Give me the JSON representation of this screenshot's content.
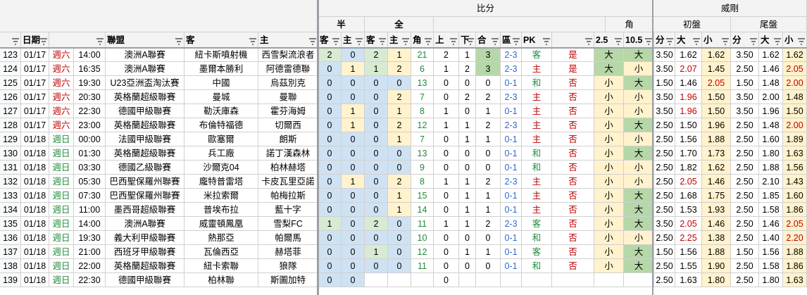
{
  "header": {
    "group_bifen": "比分",
    "group_ban": "半",
    "group_quan": "全",
    "group_jiao": "角",
    "group_weilian": "威剛",
    "group_chupan": "初盤",
    "group_weipan": "尾盤",
    "columns": [
      "日期",
      "",
      "聯盟",
      "客",
      "主",
      "客",
      "主",
      "客",
      "主",
      "角",
      "上",
      "下",
      "合",
      "區",
      "PK",
      "2.5",
      "10.5",
      "分",
      "大",
      "小",
      "分",
      "大",
      "小"
    ]
  },
  "rows": [
    {
      "n": "123",
      "d": "01/17",
      "w": "週六",
      "t": "14:00",
      "lg": "澳洲A聯賽",
      "away": "紐卡斯噴射機",
      "home": "西雪梨流浪者",
      "h1": "2",
      "h2": "0",
      "f1": "2",
      "f2": "1",
      "jiao": "21",
      "up": "2",
      "down": "1",
      "he": "3",
      "qu": "2-3",
      "pk": "客",
      "res": "是",
      "o25": "大",
      "o105": "大",
      "s1": "3.50",
      "s2": "1.62",
      "s3": "1.62",
      "e1": "3.50",
      "e2": "1.62",
      "e3": "1.62"
    },
    {
      "n": "124",
      "d": "01/17",
      "w": "週六",
      "t": "16:35",
      "lg": "澳洲A聯賽",
      "away": "墨爾本勝利",
      "home": "阿德雷德聯",
      "h1": "0",
      "h2": "1",
      "f1": "1",
      "f2": "2",
      "jiao": "6",
      "up": "1",
      "down": "2",
      "he": "3",
      "qu": "2-3",
      "pk": "主",
      "res": "是",
      "o25": "大",
      "o105": "小",
      "s1": "3.50",
      "s2": "2.07",
      "s3": "1.45",
      "e1": "2.50",
      "e2": "1.46",
      "e3": "2.05"
    },
    {
      "n": "125",
      "d": "01/17",
      "w": "週六",
      "t": "19:30",
      "lg": "U23亞洲盃淘汰賽",
      "away": "中國",
      "home": "烏茲別克",
      "h1": "0",
      "h2": "0",
      "f1": "0",
      "f2": "0",
      "jiao": "13",
      "up": "0",
      "down": "0",
      "he": "0",
      "qu": "0-1",
      "pk": "和",
      "res": "否",
      "o25": "小",
      "o105": "大",
      "s1": "1.50",
      "s2": "1.46",
      "s3": "2.05",
      "e1": "1.50",
      "e2": "1.48",
      "e3": "2.00"
    },
    {
      "n": "126",
      "d": "01/17",
      "w": "週六",
      "t": "20:30",
      "lg": "英格蘭超級聯賽",
      "away": "曼城",
      "home": "曼聯",
      "h1": "0",
      "h2": "0",
      "f1": "0",
      "f2": "2",
      "jiao": "7",
      "up": "0",
      "down": "2",
      "he": "2",
      "qu": "2-3",
      "pk": "主",
      "res": "否",
      "o25": "小",
      "o105": "小",
      "s1": "3.50",
      "s2": "1.96",
      "s3": "1.50",
      "e1": "3.50",
      "e2": "2.00",
      "e3": "1.48"
    },
    {
      "n": "127",
      "d": "01/17",
      "w": "週六",
      "t": "22:30",
      "lg": "德國甲級聯賽",
      "away": "勒沃庫森",
      "home": "霍芬海姆",
      "h1": "0",
      "h2": "1",
      "f1": "0",
      "f2": "1",
      "jiao": "8",
      "up": "1",
      "down": "0",
      "he": "1",
      "qu": "0-1",
      "pk": "主",
      "res": "否",
      "o25": "小",
      "o105": "小",
      "s1": "3.50",
      "s2": "1.96",
      "s3": "1.50",
      "e1": "3.50",
      "e2": "1.96",
      "e3": "1.50"
    },
    {
      "n": "128",
      "d": "01/17",
      "w": "週六",
      "t": "23:00",
      "lg": "英格蘭超級聯賽",
      "away": "布倫特福德",
      "home": "切爾西",
      "h1": "0",
      "h2": "1",
      "f1": "0",
      "f2": "2",
      "jiao": "12",
      "up": "1",
      "down": "1",
      "he": "2",
      "qu": "2-3",
      "pk": "主",
      "res": "否",
      "o25": "小",
      "o105": "大",
      "s1": "2.50",
      "s2": "1.50",
      "s3": "1.96",
      "e1": "2.50",
      "e2": "1.48",
      "e3": "2.00"
    },
    {
      "n": "129",
      "d": "01/18",
      "w": "週日",
      "t": "00:00",
      "lg": "法國甲級聯賽",
      "away": "歐塞爾",
      "home": "朗斯",
      "h1": "0",
      "h2": "0",
      "f1": "0",
      "f2": "1",
      "jiao": "7",
      "up": "0",
      "down": "1",
      "he": "1",
      "qu": "0-1",
      "pk": "主",
      "res": "否",
      "o25": "小",
      "o105": "小",
      "s1": "2.50",
      "s2": "1.56",
      "s3": "1.88",
      "e1": "2.50",
      "e2": "1.60",
      "e3": "1.89"
    },
    {
      "n": "130",
      "d": "01/18",
      "w": "週日",
      "t": "01:30",
      "lg": "英格蘭超級聯賽",
      "away": "兵工廠",
      "home": "諾丁漢森林",
      "h1": "0",
      "h2": "0",
      "f1": "0",
      "f2": "0",
      "jiao": "13",
      "up": "0",
      "down": "0",
      "he": "0",
      "qu": "0-1",
      "pk": "和",
      "res": "否",
      "o25": "小",
      "o105": "大",
      "s1": "2.50",
      "s2": "1.70",
      "s3": "1.73",
      "e1": "2.50",
      "e2": "1.80",
      "e3": "1.63"
    },
    {
      "n": "131",
      "d": "01/18",
      "w": "週日",
      "t": "03:30",
      "lg": "德國乙級聯賽",
      "away": "沙爾克04",
      "home": "柏林赫塔",
      "h1": "0",
      "h2": "0",
      "f1": "0",
      "f2": "0",
      "jiao": "9",
      "up": "0",
      "down": "0",
      "he": "0",
      "qu": "0-1",
      "pk": "和",
      "res": "否",
      "o25": "小",
      "o105": "小",
      "s1": "2.50",
      "s2": "1.82",
      "s3": "1.62",
      "e1": "2.50",
      "e2": "1.88",
      "e3": "1.56"
    },
    {
      "n": "132",
      "d": "01/18",
      "w": "週日",
      "t": "05:30",
      "lg": "巴西聖保羅州聯賽",
      "away": "龐特普雷塔",
      "home": "卡皮瓦里亞諾",
      "h1": "0",
      "h2": "1",
      "f1": "0",
      "f2": "2",
      "jiao": "8",
      "up": "1",
      "down": "1",
      "he": "2",
      "qu": "2-3",
      "pk": "主",
      "res": "否",
      "o25": "小",
      "o105": "小",
      "s1": "2.50",
      "s2": "2.05",
      "s3": "1.46",
      "e1": "2.50",
      "e2": "2.10",
      "e3": "1.43"
    },
    {
      "n": "133",
      "d": "01/18",
      "w": "週日",
      "t": "07:30",
      "lg": "巴西聖保羅州聯賽",
      "away": "米拉索爾",
      "home": "帕梅拉斯",
      "h1": "0",
      "h2": "0",
      "f1": "0",
      "f2": "1",
      "jiao": "15",
      "up": "0",
      "down": "1",
      "he": "1",
      "qu": "0-1",
      "pk": "主",
      "res": "否",
      "o25": "小",
      "o105": "大",
      "s1": "2.50",
      "s2": "1.68",
      "s3": "1.75",
      "e1": "2.50",
      "e2": "1.85",
      "e3": "1.60"
    },
    {
      "n": "134",
      "d": "01/18",
      "w": "週日",
      "t": "11:00",
      "lg": "墨西哥超級聯賽",
      "away": "普埃布拉",
      "home": "藍十字",
      "h1": "0",
      "h2": "0",
      "f1": "0",
      "f2": "1",
      "jiao": "14",
      "up": "0",
      "down": "1",
      "he": "1",
      "qu": "0-1",
      "pk": "主",
      "res": "否",
      "o25": "小",
      "o105": "大",
      "s1": "2.50",
      "s2": "1.53",
      "s3": "1.93",
      "e1": "2.50",
      "e2": "1.58",
      "e3": "1.86"
    },
    {
      "n": "135",
      "d": "01/18",
      "w": "週日",
      "t": "14:00",
      "lg": "澳洲A聯賽",
      "away": "威靈頓鳳凰",
      "home": "雪梨FC",
      "h1": "1",
      "h2": "0",
      "f1": "2",
      "f2": "0",
      "jiao": "11",
      "up": "1",
      "down": "1",
      "he": "2",
      "qu": "2-3",
      "pk": "客",
      "res": "否",
      "o25": "小",
      "o105": "大",
      "s1": "3.50",
      "s2": "2.05",
      "s3": "1.46",
      "e1": "2.50",
      "e2": "1.46",
      "e3": "2.05"
    },
    {
      "n": "136",
      "d": "01/18",
      "w": "週日",
      "t": "19:30",
      "lg": "義大利甲級聯賽",
      "away": "熱那亞",
      "home": "帕爾馬",
      "h1": "0",
      "h2": "0",
      "f1": "0",
      "f2": "0",
      "jiao": "10",
      "up": "0",
      "down": "0",
      "he": "0",
      "qu": "0-1",
      "pk": "和",
      "res": "否",
      "o25": "小",
      "o105": "小",
      "s1": "2.50",
      "s2": "2.25",
      "s3": "1.38",
      "e1": "2.50",
      "e2": "1.40",
      "e3": "2.20"
    },
    {
      "n": "137",
      "d": "01/18",
      "w": "週日",
      "t": "21:00",
      "lg": "西班牙甲級聯賽",
      "away": "瓦倫西亞",
      "home": "赫塔菲",
      "h1": "0",
      "h2": "0",
      "f1": "1",
      "f2": "0",
      "jiao": "12",
      "up": "0",
      "down": "1",
      "he": "1",
      "qu": "0-1",
      "pk": "客",
      "res": "否",
      "o25": "小",
      "o105": "大",
      "s1": "1.50",
      "s2": "1.56",
      "s3": "1.88",
      "e1": "1.50",
      "e2": "1.56",
      "e3": "1.88"
    },
    {
      "n": "138",
      "d": "01/18",
      "w": "週日",
      "t": "22:00",
      "lg": "英格蘭超級聯賽",
      "away": "紐卡索聯",
      "home": "狼隊",
      "h1": "0",
      "h2": "0",
      "f1": "0",
      "f2": "0",
      "jiao": "11",
      "up": "0",
      "down": "0",
      "he": "0",
      "qu": "0-1",
      "pk": "和",
      "res": "否",
      "o25": "小",
      "o105": "大",
      "s1": "2.50",
      "s2": "1.55",
      "s3": "1.90",
      "e1": "2.50",
      "e2": "1.58",
      "e3": "1.86"
    },
    {
      "n": "139",
      "d": "01/18",
      "w": "週日",
      "t": "22:30",
      "lg": "德國甲級聯賽",
      "away": "柏林聯",
      "home": "斯圖加特",
      "h1": "0",
      "h2": "0",
      "f1": "",
      "f2": "",
      "jiao": "",
      "up": "0",
      "down": "",
      "he": "",
      "qu": "",
      "pk": "",
      "res": "",
      "o25": "",
      "o105": "",
      "s1": "2.50",
      "s2": "1.63",
      "s3": "1.80",
      "e1": "2.50",
      "e2": "1.80",
      "e3": "1.63"
    }
  ],
  "colors": {
    "blue_cell": "#cfe2f3",
    "green_cell": "#d9ead3",
    "yellow_cell": "#fff2cc",
    "green_dark": "#b6d7a8",
    "red_text": "#c00000",
    "green_text": "#1e8c3a",
    "blue_text": "#2e6ad6",
    "header_bg": "#f3f3f3"
  }
}
